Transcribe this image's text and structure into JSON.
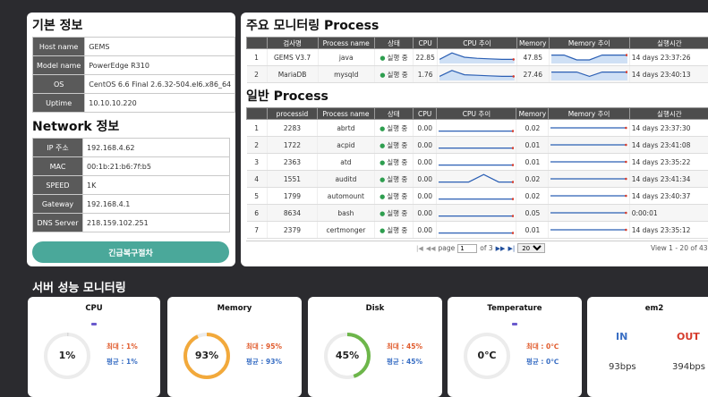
{
  "basic_info": {
    "title": "기본 정보",
    "rows": [
      {
        "label": "Host name",
        "value": "GEMS"
      },
      {
        "label": "Model name",
        "value": "PowerEdge R310"
      },
      {
        "label": "OS",
        "value": "CentOS 6.6 Final 2.6.32-504.el6.x86_64"
      },
      {
        "label": "Uptime",
        "value": "10.10.10.220"
      }
    ]
  },
  "network_info": {
    "title": "Network 정보",
    "rows": [
      {
        "label": "IP 주소",
        "value": "192.168.4.62"
      },
      {
        "label": "MAC",
        "value": "00:1b:21:b6:7f:b5"
      },
      {
        "label": "SPEED",
        "value": "1K"
      },
      {
        "label": "Gateway",
        "value": "192.168.4.1"
      },
      {
        "label": "DNS Server",
        "value": "218.159.102.251"
      }
    ]
  },
  "recovery_button": "긴급복구절차",
  "main_process": {
    "title": "주요 모니터링 Process",
    "headers": [
      "",
      "검사명",
      "Process name",
      "상태",
      "CPU",
      "CPU 추이",
      "Memory",
      "Memory 추이",
      "실행시간"
    ],
    "rows": [
      {
        "no": "1",
        "name": "GEMS V3.7",
        "process": "java",
        "status": "실행 중",
        "cpu": "22.85",
        "cpu_trend": [
          0.3,
          0.9,
          0.5,
          0.4,
          0.35,
          0.3,
          0.3
        ],
        "memory": "47.85",
        "mem_trend": [
          0.7,
          0.7,
          0.25,
          0.25,
          0.7,
          0.7,
          0.7
        ],
        "runtime": "14 days 23:37:26"
      },
      {
        "no": "2",
        "name": "MariaDB",
        "process": "mysqld",
        "status": "실행 중",
        "cpu": "1.76",
        "cpu_trend": [
          0.3,
          0.85,
          0.45,
          0.4,
          0.35,
          0.3,
          0.3
        ],
        "memory": "27.46",
        "mem_trend": [
          0.7,
          0.7,
          0.7,
          0.3,
          0.7,
          0.7,
          0.7
        ],
        "runtime": "14 days 23:40:13"
      }
    ]
  },
  "general_process": {
    "title": "일반 Process",
    "headers": [
      "",
      "processid",
      "Process name",
      "상태",
      "CPU",
      "CPU 추이",
      "Memory",
      "Memory 추이",
      "실행시간"
    ],
    "rows": [
      {
        "no": "1",
        "pid": "2283",
        "process": "abrtd",
        "status": "실행 중",
        "cpu": "0.00",
        "cpu_trend": [
          0.2,
          0.2,
          0.2,
          0.2,
          0.2,
          0.2
        ],
        "memory": "0.02",
        "mem_trend": [
          0.5,
          0.5,
          0.5,
          0.5,
          0.5,
          0.5
        ],
        "runtime": "14 days 23:37:30"
      },
      {
        "no": "2",
        "pid": "1722",
        "process": "acpid",
        "status": "실행 중",
        "cpu": "0.00",
        "cpu_trend": [
          0.2,
          0.2,
          0.2,
          0.2,
          0.2,
          0.2
        ],
        "memory": "0.01",
        "mem_trend": [
          0.5,
          0.5,
          0.5,
          0.5,
          0.5,
          0.5
        ],
        "runtime": "14 days 23:41:08"
      },
      {
        "no": "3",
        "pid": "2363",
        "process": "atd",
        "status": "실행 중",
        "cpu": "0.00",
        "cpu_trend": [
          0.2,
          0.2,
          0.2,
          0.2,
          0.2,
          0.2
        ],
        "memory": "0.01",
        "mem_trend": [
          0.5,
          0.5,
          0.5,
          0.5,
          0.5,
          0.5
        ],
        "runtime": "14 days 23:35:22"
      },
      {
        "no": "4",
        "pid": "1551",
        "process": "auditd",
        "status": "실행 중",
        "cpu": "0.00",
        "cpu_trend": [
          0.2,
          0.2,
          0.2,
          0.9,
          0.2,
          0.2
        ],
        "memory": "0.02",
        "mem_trend": [
          0.5,
          0.5,
          0.5,
          0.5,
          0.5,
          0.5
        ],
        "runtime": "14 days 23:41:34"
      },
      {
        "no": "5",
        "pid": "1799",
        "process": "automount",
        "status": "실행 중",
        "cpu": "0.00",
        "cpu_trend": [
          0.2,
          0.2,
          0.2,
          0.2,
          0.2,
          0.2
        ],
        "memory": "0.02",
        "mem_trend": [
          0.5,
          0.5,
          0.5,
          0.5,
          0.5,
          0.5
        ],
        "runtime": "14 days 23:40:37"
      },
      {
        "no": "6",
        "pid": "8634",
        "process": "bash",
        "status": "실행 중",
        "cpu": "0.00",
        "cpu_trend": [
          0.2,
          0.2,
          0.2,
          0.2,
          0.2,
          0.2
        ],
        "memory": "0.05",
        "mem_trend": [
          0.5,
          0.5,
          0.5,
          0.5,
          0.5,
          0.5
        ],
        "runtime": "0:00:01"
      },
      {
        "no": "7",
        "pid": "2379",
        "process": "certmonger",
        "status": "실행 중",
        "cpu": "0.00",
        "cpu_trend": [
          0.2,
          0.2,
          0.2,
          0.2,
          0.2,
          0.2
        ],
        "memory": "0.01",
        "mem_trend": [
          0.5,
          0.5,
          0.5,
          0.5,
          0.5,
          0.5
        ],
        "runtime": "14 days 23:35:12"
      }
    ],
    "pager": {
      "page_label": "page",
      "page_value": "1",
      "of_label": "of 3",
      "per_page": "20",
      "view_text": "View 1 - 20 of 43"
    }
  },
  "performance": {
    "title": "서버 성능 모니터링",
    "cards": [
      {
        "title": "CPU",
        "value": "1%",
        "percent": 1,
        "color": "#d9d9d9",
        "max": "최대 : 1%",
        "avg": "평균 : 1%"
      },
      {
        "title": "Memory",
        "value": "93%",
        "percent": 93,
        "color": "#f2a93b",
        "max": "최대 : 95%",
        "avg": "평균 : 93%"
      },
      {
        "title": "Disk",
        "value": "45%",
        "percent": 45,
        "color": "#6db64a",
        "max": "최대 : 45%",
        "avg": "평균 : 45%"
      },
      {
        "title": "Temperature",
        "value": "0℃",
        "percent": 0,
        "color": "#d9d9d9",
        "max": "최대 : 0℃",
        "avg": "평균 : 0℃"
      }
    ],
    "network_card": {
      "title": "em2",
      "in_label": "IN",
      "out_label": "OUT",
      "in_value": "93bps",
      "out_value": "394bps"
    }
  },
  "colors": {
    "status_dot": "#2e9e4f",
    "max_text": "#e05a2b",
    "avg_text": "#3a6fc4",
    "button": "#4aa89a"
  }
}
